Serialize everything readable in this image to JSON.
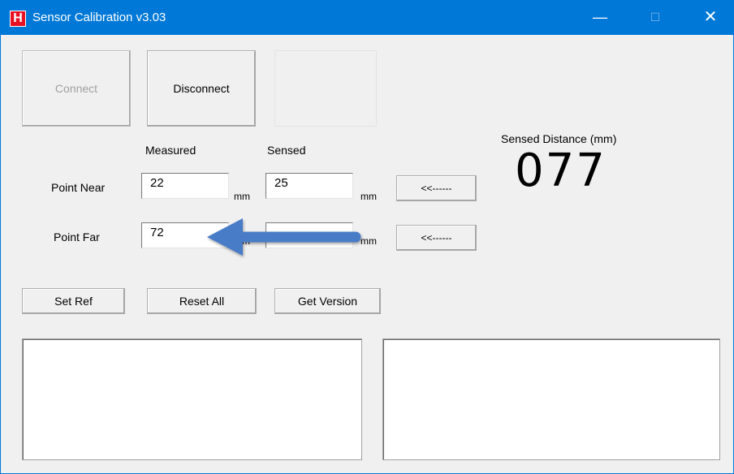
{
  "window": {
    "title": "Sensor Calibration v3.03",
    "app_icon_letter": "H",
    "minimize_glyph": "—",
    "maximize_glyph": "☐",
    "close_glyph": "✕"
  },
  "buttons": {
    "connect": "Connect",
    "disconnect": "Disconnect",
    "hidden": "",
    "arrow_near": "<<------",
    "arrow_far": "<<------",
    "set_ref": "Set Ref",
    "reset_all": "Reset All",
    "get_version": "Get Version"
  },
  "labels": {
    "measured": "Measured",
    "sensed": "Sensed",
    "point_near": "Point Near",
    "point_far": "Point Far",
    "sensed_distance": "Sensed Distance (mm)",
    "unit": "mm"
  },
  "fields": {
    "near_measured": "22",
    "near_sensed": "25",
    "far_measured": "72",
    "far_sensed": ""
  },
  "reading": {
    "sensed_distance_value": "077"
  },
  "colors": {
    "titlebar": "#0078d7",
    "annotation_arrow": "#4a7cc7",
    "app_icon": "#e81123"
  },
  "icons": {
    "app": "h-logo-icon",
    "annotation": "arrow-left-annotation"
  }
}
